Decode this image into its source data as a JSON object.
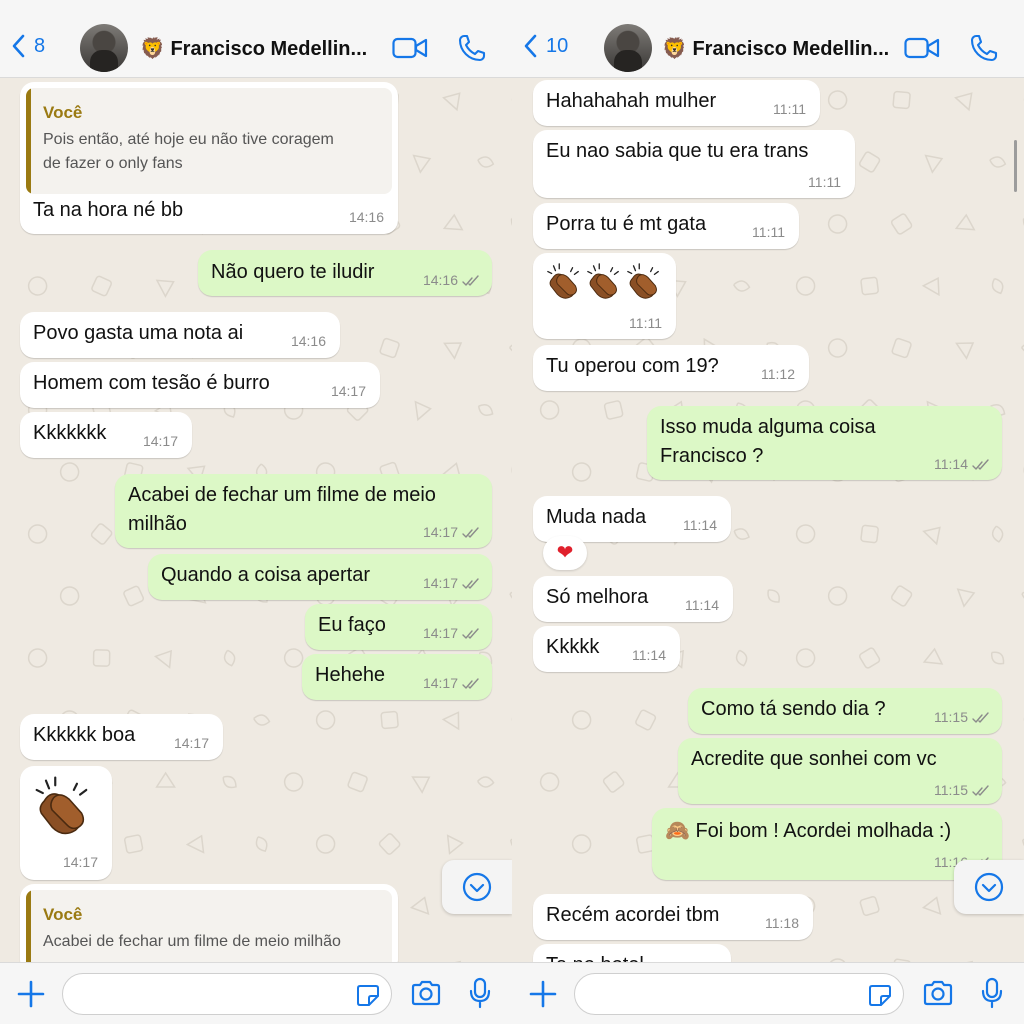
{
  "theme": {
    "accent": "#1577e8",
    "incoming_bg": "#ffffff",
    "outgoing_bg": "#dcf8c6",
    "quote_author_color": "#9a7a12",
    "tick_color": "#8b8b8b"
  },
  "left": {
    "header": {
      "back_count": "8",
      "contact_name": "🦁 Francisco Medellin...",
      "icons": [
        "video-call-icon",
        "voice-call-icon"
      ]
    },
    "messages": [
      {
        "dir": "in",
        "quote": {
          "author": "Você",
          "lines": [
            "Pois então, até hoje eu não tive coragem",
            "de fazer o only fans"
          ]
        },
        "lines": [
          "Ta na hora né bb"
        ],
        "time": "14:16"
      },
      {
        "dir": "out",
        "lines": [
          "Não quero te iludir"
        ],
        "time": "14:16",
        "read": true
      },
      {
        "dir": "in",
        "lines": [
          "Povo gasta uma nota ai"
        ],
        "time": "14:16"
      },
      {
        "dir": "in",
        "lines": [
          "Homem com tesão é burro"
        ],
        "time": "14:17"
      },
      {
        "dir": "in",
        "lines": [
          "Kkkkkkk"
        ],
        "time": "14:17"
      },
      {
        "dir": "out",
        "lines": [
          "Acabei de fechar um filme de meio",
          "milhão"
        ],
        "time": "14:17",
        "read": true
      },
      {
        "dir": "out",
        "lines": [
          "Quando a coisa apertar"
        ],
        "time": "14:17",
        "read": true
      },
      {
        "dir": "out",
        "lines": [
          "Eu faço"
        ],
        "time": "14:17",
        "read": true
      },
      {
        "dir": "out",
        "lines": [
          "Hehehe"
        ],
        "time": "14:17",
        "read": true
      },
      {
        "dir": "in",
        "lines": [
          "Kkkkkk boa"
        ],
        "time": "14:17"
      },
      {
        "dir": "in",
        "emoji": "clapping-hands",
        "time": "14:17"
      },
      {
        "dir": "in",
        "quote": {
          "author": "Você",
          "lines": [
            "Acabei de fechar um filme de meio milhão"
          ]
        }
      }
    ],
    "input": {
      "value": ""
    }
  },
  "right": {
    "header": {
      "back_count": "10",
      "contact_name": "🦁 Francisco Medellin...",
      "icons": [
        "video-call-icon",
        "voice-call-icon"
      ]
    },
    "messages": [
      {
        "dir": "in",
        "lines": [
          "Hahahahah mulher"
        ],
        "time": "11:11"
      },
      {
        "dir": "in",
        "lines": [
          "Eu nao sabia que tu era trans"
        ],
        "time": "11:11"
      },
      {
        "dir": "in",
        "lines": [
          "Porra tu é mt gata"
        ],
        "time": "11:11"
      },
      {
        "dir": "in",
        "emoji": "clapping-hands-x3",
        "time": "11:11"
      },
      {
        "dir": "in",
        "lines": [
          "Tu operou com 19?"
        ],
        "time": "11:12"
      },
      {
        "dir": "out",
        "lines": [
          "Isso muda alguma coisa",
          "Francisco ?"
        ],
        "time": "11:14",
        "read": true
      },
      {
        "dir": "in",
        "lines": [
          "Muda nada"
        ],
        "time": "11:14",
        "reaction": "❤"
      },
      {
        "dir": "in",
        "lines": [
          "Só melhora"
        ],
        "time": "11:14"
      },
      {
        "dir": "in",
        "lines": [
          "Kkkkk"
        ],
        "time": "11:14"
      },
      {
        "dir": "out",
        "lines": [
          "Como tá sendo dia ?"
        ],
        "time": "11:15",
        "read": true
      },
      {
        "dir": "out",
        "lines": [
          "Acredite que sonhei com vc"
        ],
        "time": "11:15",
        "read": true
      },
      {
        "dir": "out",
        "lines": [
          "🙈 Foi bom ! Acordei molhada :)"
        ],
        "time": "11:16",
        "read": true
      },
      {
        "dir": "in",
        "lines": [
          "Recém acordei tbm"
        ],
        "time": "11:18"
      },
      {
        "dir": "in",
        "lines": [
          "Ta no hotel"
        ]
      }
    ],
    "input": {
      "value": ""
    }
  }
}
